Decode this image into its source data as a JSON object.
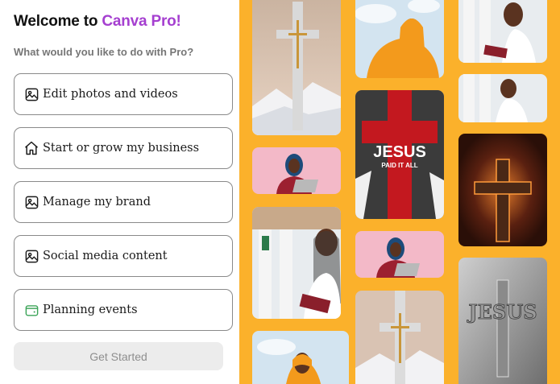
{
  "welcome": {
    "prefix": "Welcome to ",
    "brand": "Canva Pro!"
  },
  "subtitle": "What would you like to do with Pro?",
  "options": [
    {
      "label": "Edit photos and videos",
      "icon": "image-icon"
    },
    {
      "label": "Start or grow my business",
      "icon": "home-icon"
    },
    {
      "label": "Manage my brand",
      "icon": "image-icon"
    },
    {
      "label": "Social media content",
      "icon": "image-icon"
    },
    {
      "label": "Planning events",
      "icon": "wallet-icon"
    }
  ],
  "cta_label": "Get Started",
  "gallery": {
    "jesus_banner_title": "JESUS",
    "jesus_banner_subtitle": "PAID IT ALL",
    "jesus_emblem_text": "JESUS"
  },
  "colors": {
    "brand_accent": "#a53fd0",
    "gallery_background": "#fbb12b",
    "event_icon": "#3aa357"
  }
}
